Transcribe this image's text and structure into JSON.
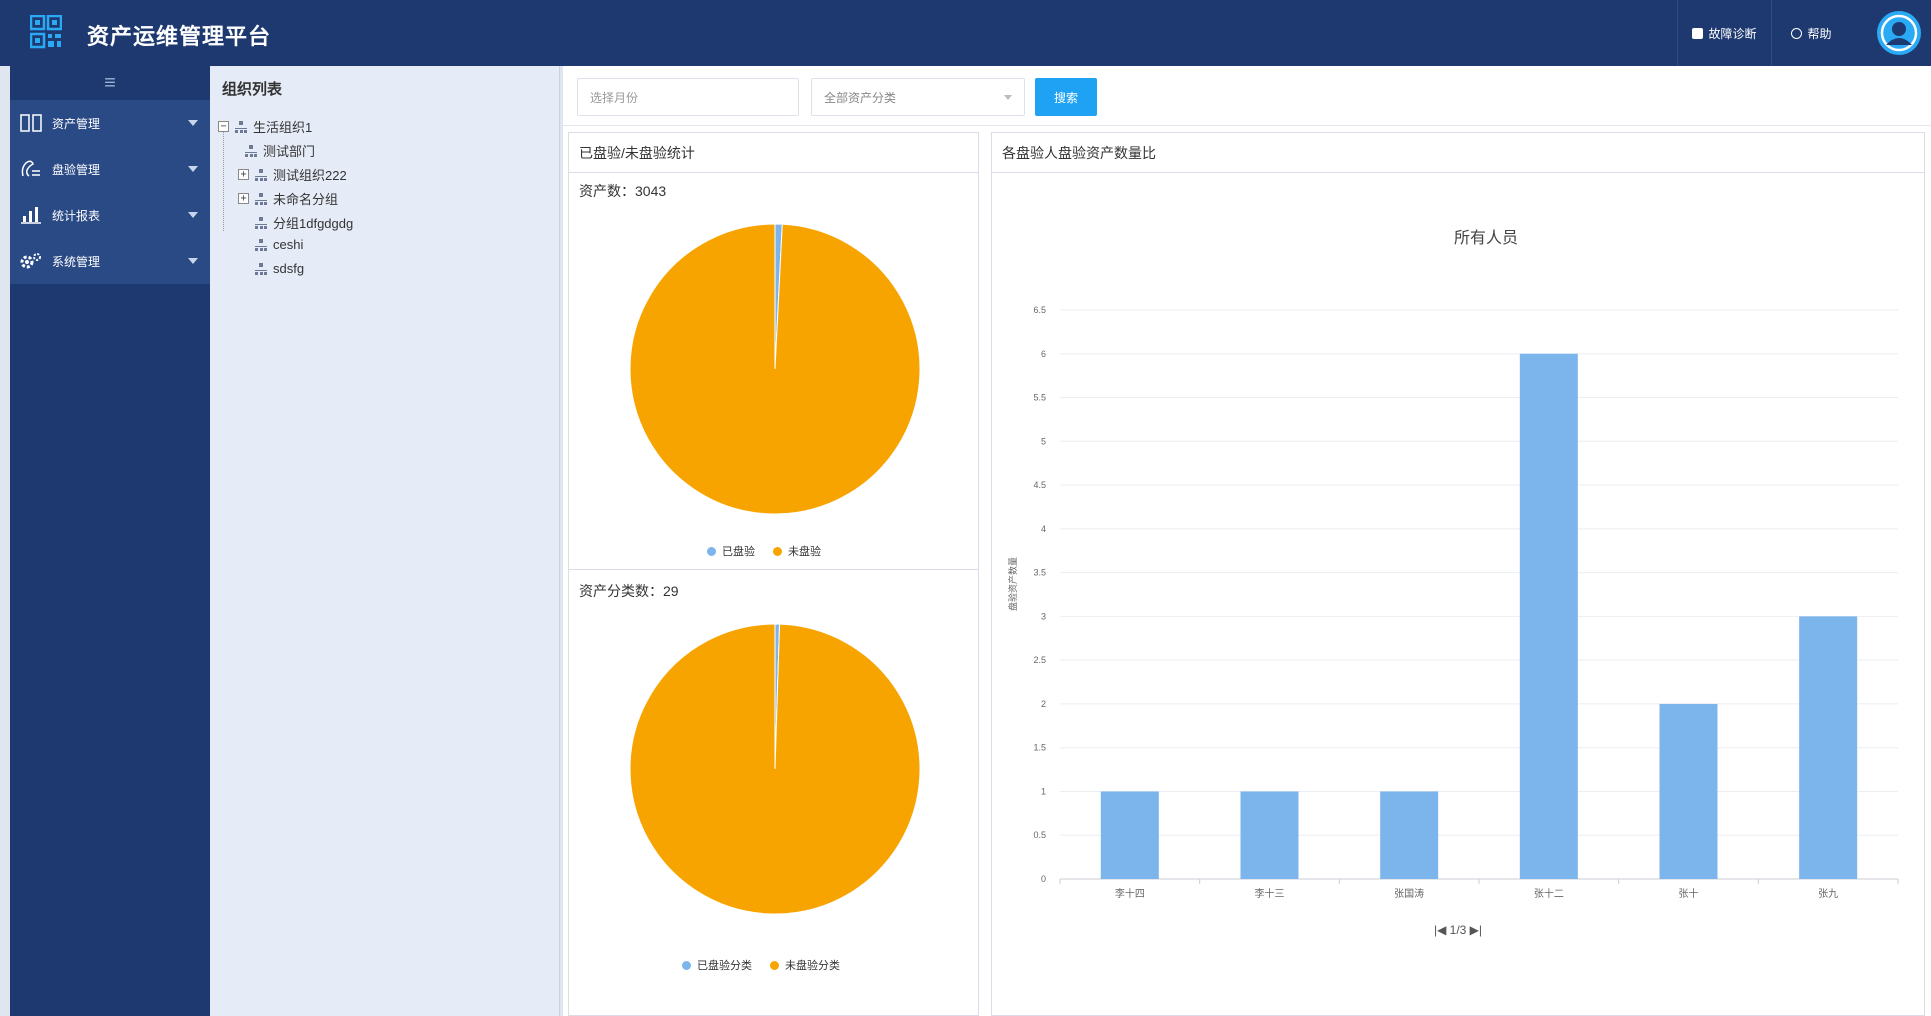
{
  "app": {
    "title": "资产运维管理平台"
  },
  "header": {
    "diagnose_label": "故障诊断",
    "help_label": "帮助"
  },
  "colors": {
    "navy": "#1d3970",
    "accent": "#1fa2f3",
    "checked": "#7cb5ec",
    "unchecked": "#f7a400"
  },
  "sidebar": {
    "toggle": "≡",
    "items": [
      {
        "label": "资产管理",
        "icon": "asset-icon"
      },
      {
        "label": "盘验管理",
        "icon": "check-icon"
      },
      {
        "label": "统计报表",
        "icon": "report-icon"
      },
      {
        "label": "系统管理",
        "icon": "settings-icon"
      }
    ]
  },
  "org": {
    "title": "组织列表",
    "tree": [
      {
        "label": "生活组织1",
        "toggle": "−"
      },
      {
        "label": "测试部门"
      },
      {
        "label": "测试组织222",
        "toggle": "+"
      },
      {
        "label": "未命名分组",
        "toggle": "+"
      },
      {
        "label": "分组1dfgdgdg"
      },
      {
        "label": "ceshi"
      },
      {
        "label": "sdsfg"
      }
    ]
  },
  "search": {
    "month_placeholder": "选择月份",
    "category_value": "全部资产分类",
    "button_label": "搜索"
  },
  "panels": {
    "checked_stats": {
      "title": "已盘验/未盘验统计",
      "asset_count_label": "资产数：3043",
      "category_count_label": "资产分类数：29"
    },
    "per_person": {
      "title": "各盘验人盘验资产数量比",
      "pager": "|◀ 1/3 ▶|"
    }
  },
  "chart_data": [
    {
      "type": "pie",
      "labels": [
        "已盘验",
        "未盘验"
      ],
      "values": [
        0.8,
        99.2
      ],
      "colors": [
        "#7cb5ec",
        "#f7a400"
      ],
      "legend": "bottom"
    },
    {
      "type": "pie",
      "labels": [
        "已盘验分类",
        "未盘验分类"
      ],
      "values": [
        0.5,
        99.5
      ],
      "colors": [
        "#7cb5ec",
        "#f7a400"
      ],
      "legend": "bottom"
    },
    {
      "type": "bar",
      "title": "所有人员",
      "ylabel": "盘验资产数量",
      "categories": [
        "李十四",
        "李十三",
        "张国涛",
        "张十二",
        "张十",
        "张九"
      ],
      "values": [
        1,
        1,
        1,
        6,
        2,
        3
      ],
      "ylim": [
        0,
        6.5
      ],
      "yticks": [
        "0",
        "0.5",
        "1",
        "1.5",
        "2",
        "2.5",
        "3",
        "3.5",
        "4",
        "4.5",
        "5",
        "5.5",
        "6",
        "6.5"
      ],
      "grid": true,
      "color": "#7cb5ec"
    }
  ]
}
